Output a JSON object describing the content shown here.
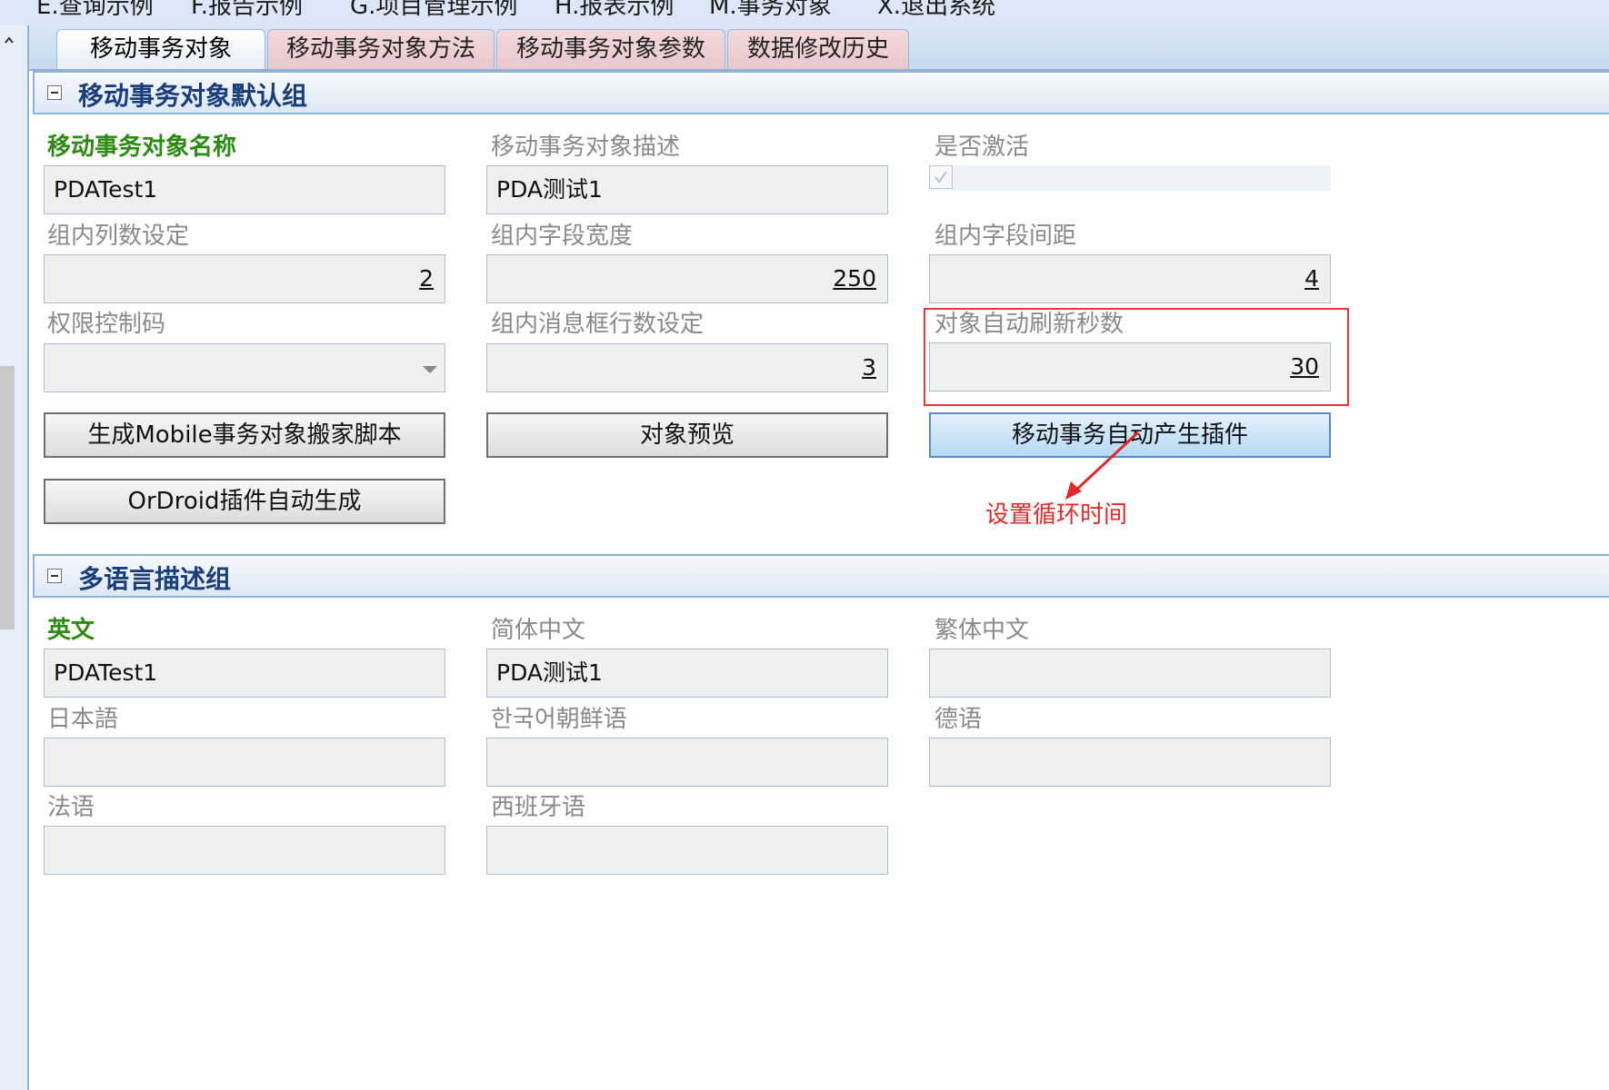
{
  "menubar": {
    "items": [
      "E.查询示例",
      "F.报告示例",
      "G.项目管理示例",
      "H.报表示例",
      "M.事务对象",
      "X.退出系统"
    ]
  },
  "tabs": [
    "移动事务对象",
    "移动事务对象方法",
    "移动事务对象参数",
    "数据修改历史"
  ],
  "group1": {
    "title": "移动事务对象默认组",
    "fields": {
      "name": {
        "label": "移动事务对象名称",
        "value": "PDATest1"
      },
      "desc": {
        "label": "移动事务对象描述",
        "value": "PDA测试1"
      },
      "active": {
        "label": "是否激活",
        "checked": true
      },
      "cols": {
        "label": "组内列数设定",
        "value": "2"
      },
      "width": {
        "label": "组内字段宽度",
        "value": "250"
      },
      "spacing": {
        "label": "组内字段间距",
        "value": "4"
      },
      "perm": {
        "label": "权限控制码",
        "value": ""
      },
      "msgrows": {
        "label": "组内消息框行数设定",
        "value": "3"
      },
      "refresh": {
        "label": "对象自动刷新秒数",
        "value": "30"
      }
    },
    "buttons": {
      "gen_script": "生成Mobile事务对象搬家脚本",
      "preview": "对象预览",
      "auto_plugin": "移动事务自动产生插件",
      "ordroid": "OrDroid插件自动生成"
    }
  },
  "group2": {
    "title": "多语言描述组",
    "fields": {
      "en": {
        "label": "英文",
        "value": "PDATest1"
      },
      "zh_cn": {
        "label": "简体中文",
        "value": "PDA测试1"
      },
      "zh_tw": {
        "label": "繁体中文",
        "value": ""
      },
      "ja": {
        "label": "日本語",
        "value": ""
      },
      "ko": {
        "label": "한국어朝鲜语",
        "value": ""
      },
      "de": {
        "label": "德语",
        "value": ""
      },
      "fr": {
        "label": "法语",
        "value": ""
      },
      "es": {
        "label": "西班牙语",
        "value": ""
      }
    }
  },
  "annotation": {
    "text": "设置循环时间",
    "color": "#e02a2a"
  }
}
